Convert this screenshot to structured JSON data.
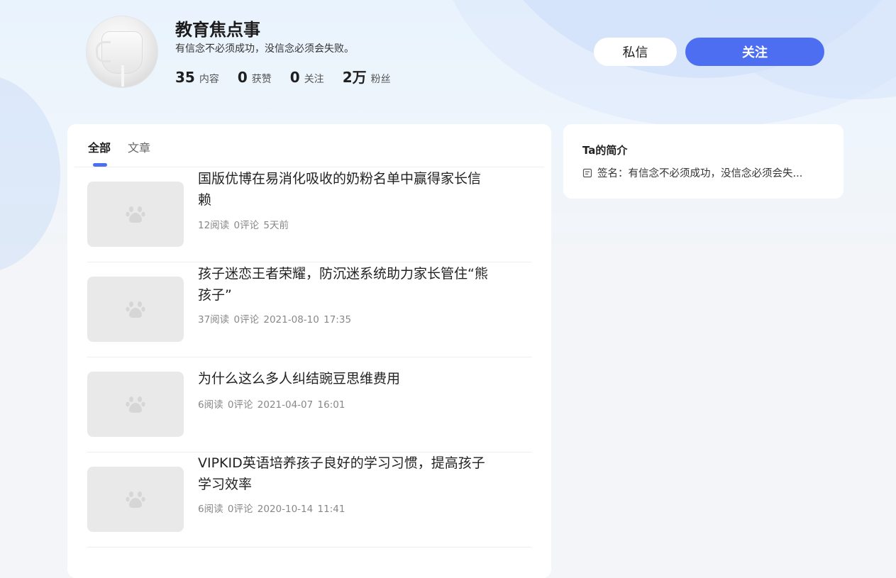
{
  "profile": {
    "name": "教育焦点事",
    "signature": "有信念不必须成功，没信念必须会失败。",
    "stats": [
      {
        "value": "35",
        "label": "内容"
      },
      {
        "value": "0",
        "label": "获赞"
      },
      {
        "value": "0",
        "label": "关注"
      },
      {
        "value": "2万",
        "label": "粉丝"
      }
    ]
  },
  "actions": {
    "message_label": "私信",
    "follow_label": "关注"
  },
  "tabs": [
    {
      "label": "全部"
    },
    {
      "label": "文章"
    }
  ],
  "articles": [
    {
      "title": "国版优博在易消化吸收的奶粉名单中赢得家长信赖",
      "reads": "12阅读",
      "comments": "0评论",
      "time": "5天前"
    },
    {
      "title": "孩子迷恋王者荣耀，防沉迷系统助力家长管住“熊孩子”",
      "reads": "37阅读",
      "comments": "0评论",
      "time": "2021-08-10 17:35"
    },
    {
      "title": "为什么这么多人纠结豌豆思维费用",
      "reads": "6阅读",
      "comments": "0评论",
      "time": "2021-04-07 16:01"
    },
    {
      "title": "VIPKID英语培养孩子良好的学习习惯，提高孩子学习效率",
      "reads": "6阅读",
      "comments": "0评论",
      "time": "2020-10-14 11:41"
    }
  ],
  "intro": {
    "title": "Ta的简介",
    "signature_text": "签名：有信念不必须成功，没信念必须会失..."
  },
  "colors": {
    "accent": "#4e6ef2",
    "thumb_placeholder": "#e9e9e9"
  },
  "icons": {
    "thumb": "baidu-paw-icon",
    "intro": "document-icon"
  }
}
